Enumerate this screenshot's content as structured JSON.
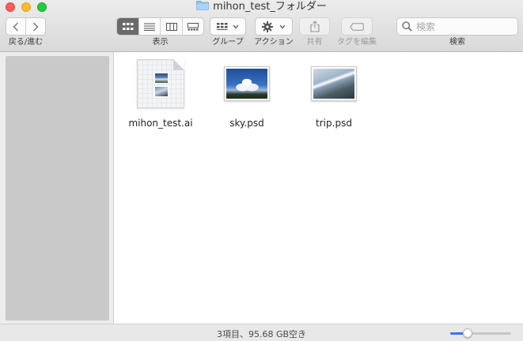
{
  "window": {
    "title": "mihon_test_フォルダー"
  },
  "toolbar": {
    "nav_label": "戻る/進む",
    "view_label": "表示",
    "group_label": "グループ",
    "action_label": "アクション",
    "share_label": "共有",
    "tags_label": "タグを編集",
    "search_label": "検索",
    "search_placeholder": "検索",
    "active_view": "icon"
  },
  "files": [
    {
      "name": "mihon_test.ai",
      "kind": "illustrator-document"
    },
    {
      "name": "sky.psd",
      "kind": "photo-sky"
    },
    {
      "name": "trip.psd",
      "kind": "photo-trip"
    }
  ],
  "status": {
    "text": "3項目、95.68 GB空き",
    "icon_size_fraction": 0.25
  },
  "colors": {
    "close": "#ff5f57",
    "minimize": "#febc2e",
    "maximize": "#28c840",
    "accent": "#3478f6",
    "sidebar": "#c9c9c9"
  }
}
